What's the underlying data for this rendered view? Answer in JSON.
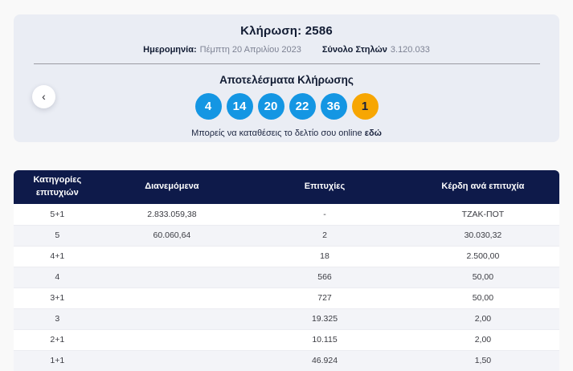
{
  "colors": {
    "ball_blue": "#1496e3",
    "ball_orange": "#f7a602",
    "header_navy": "#0e1a4a",
    "panel_bg": "#eaedf4",
    "stripe_gray": "#f3f4f8"
  },
  "draw_panel": {
    "title_label": "Κλήρωση:",
    "title_value": "2586",
    "date_label": "Ημερομηνία:",
    "date_value": "Πέμπτη 20 Απριλίου 2023",
    "columns_label": "Σύνολο Στηλών",
    "columns_value": "3.120.033",
    "results_title": "Αποτελέσματα Κλήρωσης",
    "numbers": [
      "4",
      "14",
      "20",
      "22",
      "36"
    ],
    "joker_number": "1",
    "footer_text": "Μπορείς να καταθέσεις το δελτίο σου online",
    "footer_link_label": "εδώ",
    "prev_icon": "‹"
  },
  "table": {
    "headers": [
      "Κατηγορίες επιτυχιών",
      "Διανεμόμενα",
      "Επιτυχίες",
      "Κέρδη ανά επιτυχία"
    ],
    "rows": [
      {
        "category": "5+1",
        "distributed": "2.833.059,38",
        "winners": "-",
        "prize": "ΤΖΑΚ-ΠΟΤ"
      },
      {
        "category": "5",
        "distributed": "60.060,64",
        "winners": "2",
        "prize": "30.030,32"
      },
      {
        "category": "4+1",
        "distributed": "",
        "winners": "18",
        "prize": "2.500,00"
      },
      {
        "category": "4",
        "distributed": "",
        "winners": "566",
        "prize": "50,00"
      },
      {
        "category": "3+1",
        "distributed": "",
        "winners": "727",
        "prize": "50,00"
      },
      {
        "category": "3",
        "distributed": "",
        "winners": "19.325",
        "prize": "2,00"
      },
      {
        "category": "2+1",
        "distributed": "",
        "winners": "10.115",
        "prize": "2,00"
      },
      {
        "category": "1+1",
        "distributed": "",
        "winners": "46.924",
        "prize": "1,50"
      }
    ]
  }
}
